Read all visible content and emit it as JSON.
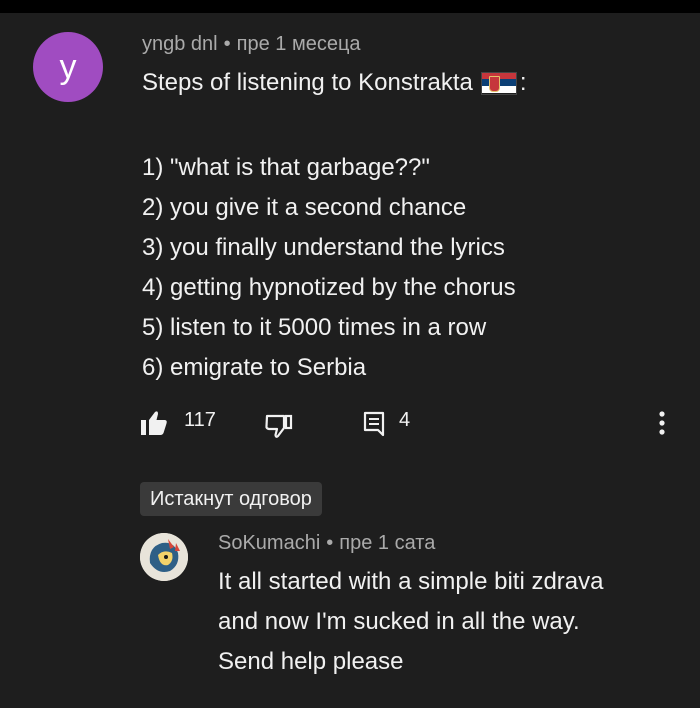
{
  "comment": {
    "avatar_letter": "y",
    "author": "yngb dnl",
    "separator": "•",
    "time": "пре 1 месеца",
    "title_text": "Steps of listening to Konstrakta",
    "title_suffix": ":",
    "flag_icon": "serbian-flag-icon",
    "lines": [
      "1) \"what is that garbage??\"",
      "2) you give it a second chance",
      "3) you finally understand the lyrics",
      "4) getting hypnotized by the chorus",
      "5) listen to it 5000 times in a row",
      "6) emigrate to Serbia"
    ],
    "like_count": "117",
    "reply_count": "4",
    "accent_avatar_color": "#a04cc1"
  },
  "pinned_reply_label": "Истакнут одговор",
  "reply": {
    "author": "SoKumachi",
    "separator": "•",
    "time": "пре 1 сата",
    "lines": [
      "It all started with a simple biti zdrava",
      "and now I'm sucked in all the way.",
      "Send help please"
    ]
  }
}
